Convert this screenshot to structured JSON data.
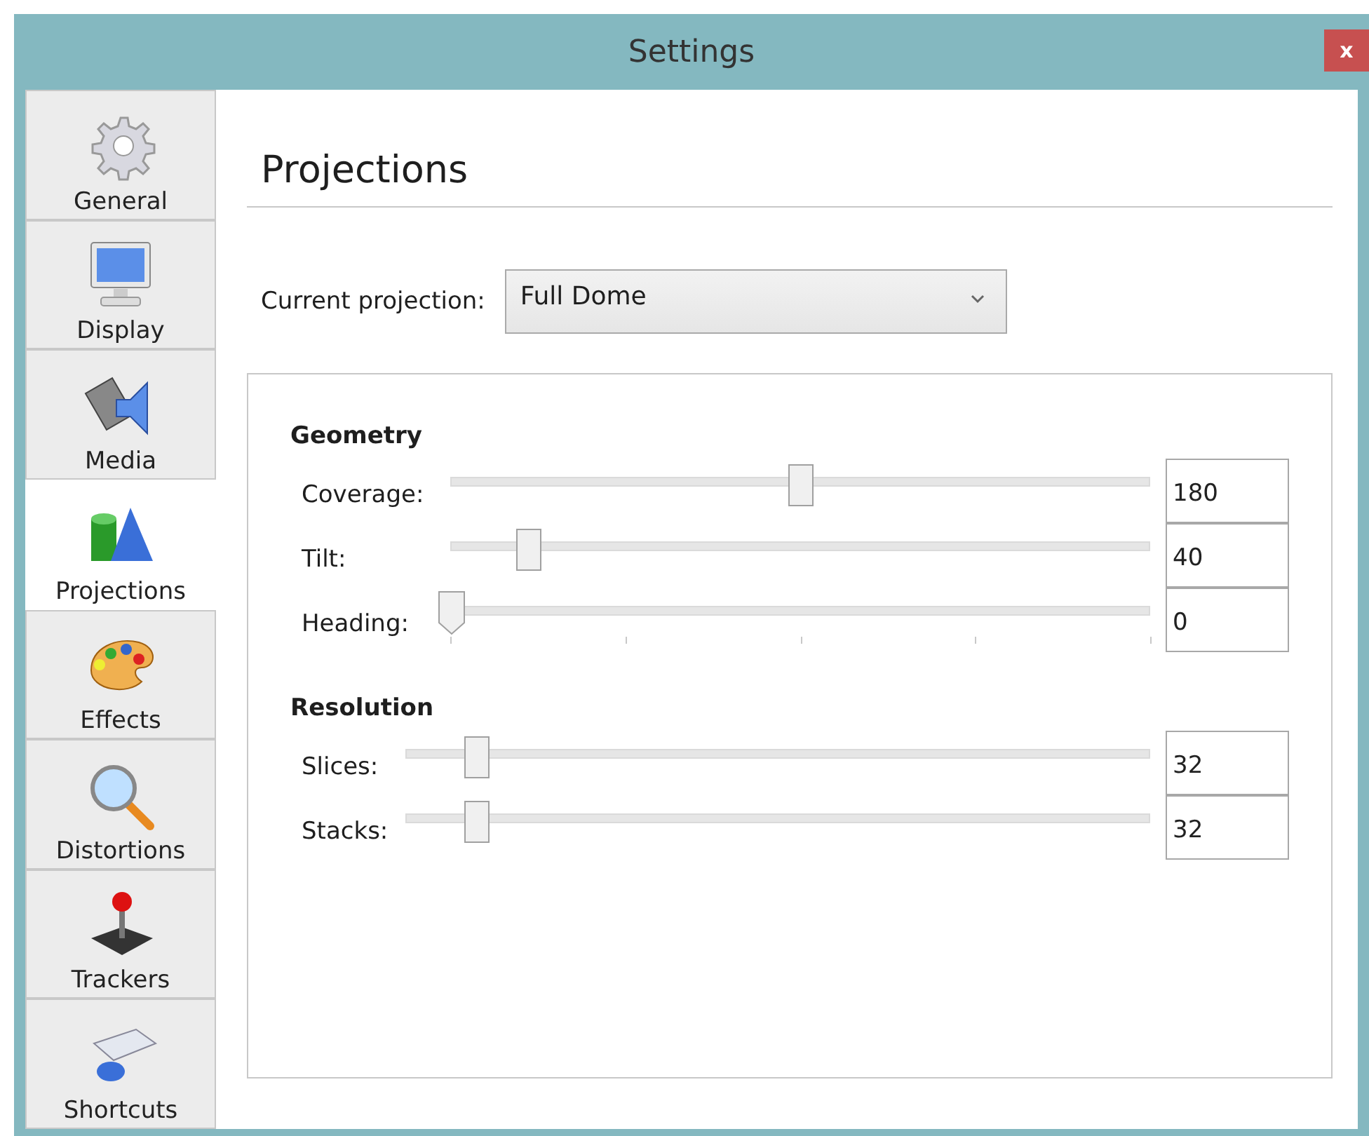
{
  "window": {
    "title": "Settings",
    "close": "x"
  },
  "sidebar": {
    "items": [
      {
        "label": "General",
        "selected": false
      },
      {
        "label": "Display",
        "selected": false
      },
      {
        "label": "Media",
        "selected": false
      },
      {
        "label": "Projections",
        "selected": true
      },
      {
        "label": "Effects",
        "selected": false
      },
      {
        "label": "Distortions",
        "selected": false
      },
      {
        "label": "Trackers",
        "selected": false
      },
      {
        "label": "Shortcuts",
        "selected": false
      }
    ]
  },
  "page": {
    "title": "Projections",
    "projection": {
      "label": "Current projection:",
      "value": "Full Dome"
    },
    "groups": [
      {
        "title": "Geometry",
        "sliders": [
          {
            "label": "Coverage:",
            "level": 0.5,
            "value": "180",
            "ticks": false
          },
          {
            "label": "Tilt:",
            "level": 0.11,
            "value": "40",
            "ticks": false
          },
          {
            "label": "Heading:",
            "level": 0,
            "value": "0",
            "ticks": true
          }
        ]
      },
      {
        "title": "Resolution",
        "sliders": [
          {
            "label": "Slices:",
            "level": 0.095,
            "value": "32",
            "ticks": false
          },
          {
            "label": "Stacks:",
            "level": 0.095,
            "value": "32",
            "ticks": false
          }
        ]
      }
    ]
  }
}
